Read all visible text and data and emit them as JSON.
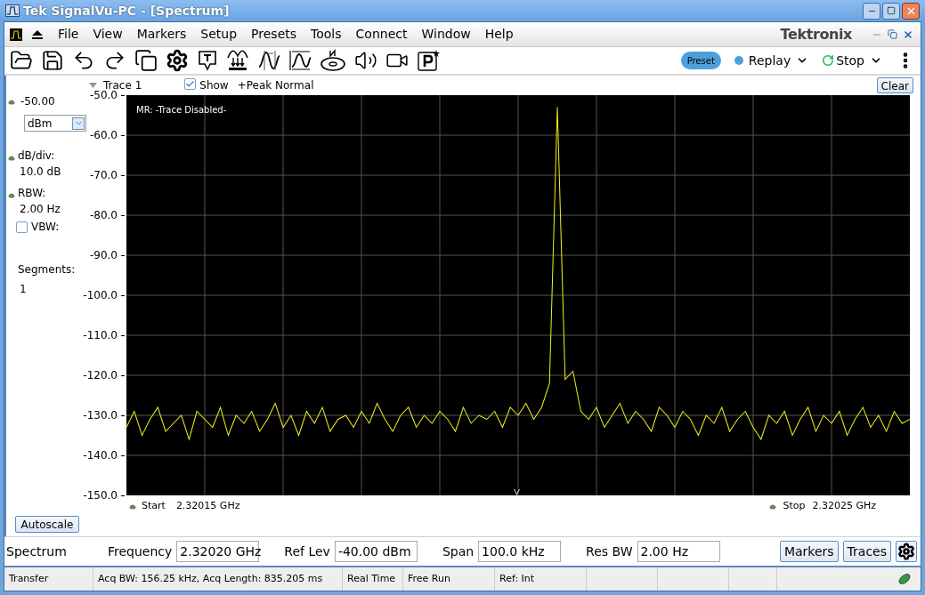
{
  "window": {
    "title": "Tek SignalVu-PC - [Spectrum]"
  },
  "menu": [
    {
      "label": "File"
    },
    {
      "label": "View"
    },
    {
      "label": "Markers"
    },
    {
      "label": "Setup"
    },
    {
      "label": "Presets"
    },
    {
      "label": "Tools"
    },
    {
      "label": "Connect"
    },
    {
      "label": "Window"
    },
    {
      "label": "Help"
    }
  ],
  "brand": "Tektronix",
  "toolbar": {
    "preset": "Preset",
    "replay": "Replay",
    "stop": "Stop"
  },
  "trace_header": {
    "show": {
      "label": "Show",
      "checked": true
    },
    "detection": "+Peak Normal",
    "clear": "Clear"
  },
  "left_panel": {
    "ref_value": "-50.00",
    "unit": "dBm",
    "db_div_label": "dB/div:",
    "db_div_value": "10.0 dB",
    "rbw_label": "RBW:",
    "rbw_value": "2.00 Hz",
    "vbw": {
      "label": "VBW:",
      "checked": false
    },
    "segments_label": "Segments:",
    "segments_value": "1",
    "autoscale": "Autoscale"
  },
  "plot": {
    "marker_readout": "MR: -Trace Disabled-",
    "chart_data": {
      "type": "line",
      "grid": true,
      "ylim": [
        -150,
        -50
      ],
      "yticks": [
        {
          "value": -50,
          "label": "-50.0"
        },
        {
          "value": -60,
          "label": "-60.0"
        },
        {
          "value": -70,
          "label": "-70.0"
        },
        {
          "value": -80,
          "label": "-80.0"
        },
        {
          "value": -90,
          "label": "-90.0"
        },
        {
          "value": -100,
          "label": "-100.0"
        },
        {
          "value": -110,
          "label": "-110.0"
        },
        {
          "value": -120,
          "label": "-120.0"
        },
        {
          "value": -130,
          "label": "-130.0"
        },
        {
          "value": -140,
          "label": "-140.0"
        },
        {
          "value": -150,
          "label": "-150.0"
        }
      ],
      "series": [
        {
          "name": "Trace 1",
          "color": "#f2f21a",
          "values": [
            -133,
            -129,
            -135,
            -131,
            -128,
            -134,
            -132,
            -130,
            -136,
            -129,
            -131,
            -133,
            -128,
            -135,
            -130,
            -132,
            -129,
            -134,
            -131,
            -127,
            -133,
            -130,
            -135,
            -129,
            -132,
            -128,
            -134,
            -131,
            -130,
            -133,
            -129,
            -132,
            -127,
            -131,
            -134,
            -130,
            -128,
            -133,
            -130,
            -132,
            -129,
            -131,
            -134,
            -128,
            -132,
            -130,
            -131,
            -129,
            -133,
            -128,
            -130,
            -127,
            -131,
            -128,
            -122,
            -53,
            -121,
            -119,
            -129,
            -131,
            -128,
            -133,
            -130,
            -127,
            -132,
            -129,
            -131,
            -134,
            -128,
            -130,
            -133,
            -129,
            -131,
            -135,
            -130,
            -132,
            -128,
            -134,
            -131,
            -129,
            -133,
            -136,
            -130,
            -132,
            -129,
            -135,
            -131,
            -128,
            -134,
            -130,
            -132,
            -129,
            -135,
            -131,
            -128,
            -133,
            -130,
            -134,
            -129,
            -132,
            -131
          ]
        }
      ]
    },
    "start_label": "Start",
    "start_value": "2.32015 GHz",
    "stop_label": "Stop",
    "stop_value": "2.32025 GHz"
  },
  "settings_bar": {
    "title": "Spectrum",
    "fields": [
      {
        "label": "Frequency",
        "value": "2.32020 GHz"
      },
      {
        "label": "Ref Lev",
        "value": "-40.00 dBm"
      },
      {
        "label": "Span",
        "value": "100.0 kHz"
      },
      {
        "label": "Res BW",
        "value": "2.00 Hz"
      }
    ],
    "buttons": [
      "Markers",
      "Traces"
    ]
  },
  "status_bar": [
    "Transfer",
    "Acq BW: 156.25 kHz, Acq Length: 835.205 ms",
    "Real Time",
    "Free Run",
    "Ref: Int"
  ]
}
